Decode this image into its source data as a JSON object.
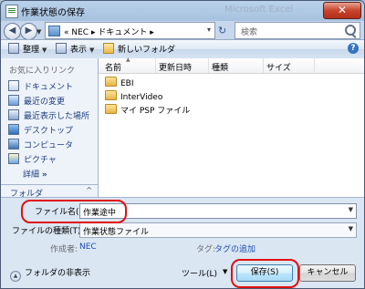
{
  "window": {
    "title": "作業状態の保存",
    "background_title": "Microsoft Excel",
    "close_glyph": "✕"
  },
  "address": {
    "back_glyph": "◀",
    "forward_glyph": "▶",
    "path_prefix": "«",
    "path_parts": [
      "NEC",
      "ドキュメント"
    ],
    "separator": "▸",
    "search_placeholder": "検索"
  },
  "toolbar": {
    "organize": "整理",
    "views": "表示",
    "new_folder": "新しいフォルダ"
  },
  "sidebar": {
    "favorites_header": "お気に入りリンク",
    "items": [
      {
        "label": "ドキュメント",
        "icon": "documents-icon"
      },
      {
        "label": "最近の変更",
        "icon": "recent-changes-icon"
      },
      {
        "label": "最近表示した場所",
        "icon": "recent-places-icon"
      },
      {
        "label": "デスクトップ",
        "icon": "desktop-icon"
      },
      {
        "label": "コンピュータ",
        "icon": "computer-icon"
      },
      {
        "label": "ピクチャ",
        "icon": "pictures-icon"
      }
    ],
    "more_label": "詳細",
    "more_glyph": "»",
    "folders_label": "フォルダ",
    "folders_caret": "^"
  },
  "filelist": {
    "columns": [
      "名前",
      "更新日時",
      "種類",
      "サイズ"
    ],
    "rows": [
      {
        "name": "EBI"
      },
      {
        "name": "InterVideo"
      },
      {
        "name": "マイ PSP ファイル"
      }
    ]
  },
  "form": {
    "filename_label": "ファイル名(N):",
    "filename_value": "作業途中",
    "filetype_label": "ファイルの種類(T):",
    "filetype_value": "作業状態ファイル",
    "author_label": "作成者:",
    "author_value": "NEC",
    "tags_label": "タグ:",
    "tags_value": "タグの追加",
    "hide_folders": "フォルダの非表示",
    "tools": "ツール(L)",
    "save": "保存(S)",
    "cancel": "キャンセル"
  },
  "colors": {
    "highlight_ring": "#e01010",
    "link_blue": "#1e3d7a"
  }
}
